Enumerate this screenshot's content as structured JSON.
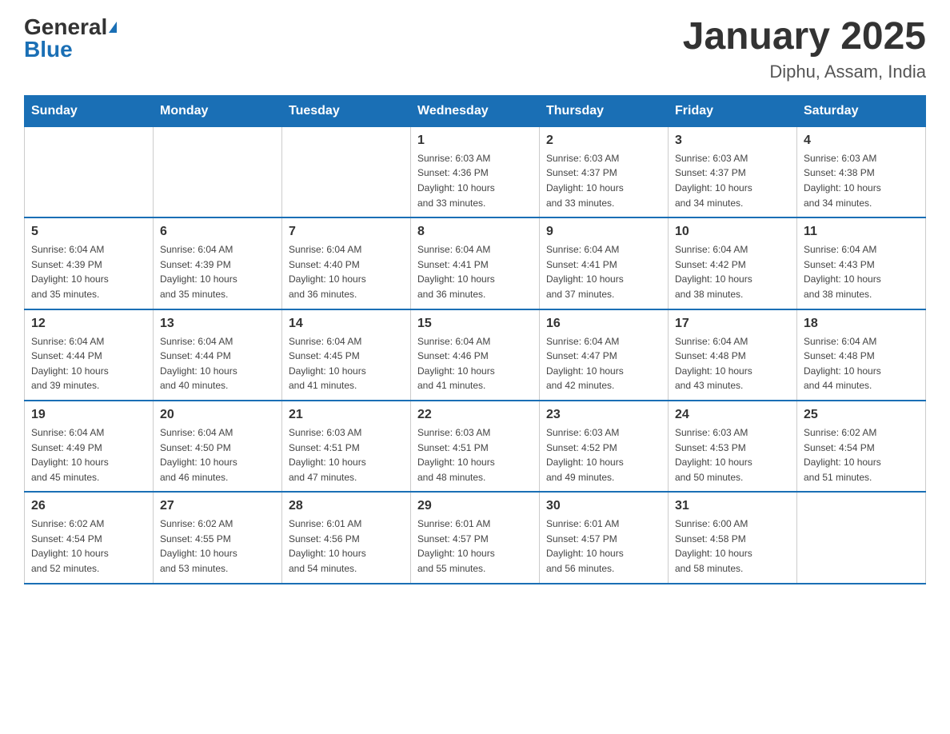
{
  "logo": {
    "general": "General",
    "blue": "Blue"
  },
  "header": {
    "title": "January 2025",
    "subtitle": "Diphu, Assam, India"
  },
  "weekdays": [
    "Sunday",
    "Monday",
    "Tuesday",
    "Wednesday",
    "Thursday",
    "Friday",
    "Saturday"
  ],
  "weeks": [
    [
      {
        "day": "",
        "info": ""
      },
      {
        "day": "",
        "info": ""
      },
      {
        "day": "",
        "info": ""
      },
      {
        "day": "1",
        "info": "Sunrise: 6:03 AM\nSunset: 4:36 PM\nDaylight: 10 hours\nand 33 minutes."
      },
      {
        "day": "2",
        "info": "Sunrise: 6:03 AM\nSunset: 4:37 PM\nDaylight: 10 hours\nand 33 minutes."
      },
      {
        "day": "3",
        "info": "Sunrise: 6:03 AM\nSunset: 4:37 PM\nDaylight: 10 hours\nand 34 minutes."
      },
      {
        "day": "4",
        "info": "Sunrise: 6:03 AM\nSunset: 4:38 PM\nDaylight: 10 hours\nand 34 minutes."
      }
    ],
    [
      {
        "day": "5",
        "info": "Sunrise: 6:04 AM\nSunset: 4:39 PM\nDaylight: 10 hours\nand 35 minutes."
      },
      {
        "day": "6",
        "info": "Sunrise: 6:04 AM\nSunset: 4:39 PM\nDaylight: 10 hours\nand 35 minutes."
      },
      {
        "day": "7",
        "info": "Sunrise: 6:04 AM\nSunset: 4:40 PM\nDaylight: 10 hours\nand 36 minutes."
      },
      {
        "day": "8",
        "info": "Sunrise: 6:04 AM\nSunset: 4:41 PM\nDaylight: 10 hours\nand 36 minutes."
      },
      {
        "day": "9",
        "info": "Sunrise: 6:04 AM\nSunset: 4:41 PM\nDaylight: 10 hours\nand 37 minutes."
      },
      {
        "day": "10",
        "info": "Sunrise: 6:04 AM\nSunset: 4:42 PM\nDaylight: 10 hours\nand 38 minutes."
      },
      {
        "day": "11",
        "info": "Sunrise: 6:04 AM\nSunset: 4:43 PM\nDaylight: 10 hours\nand 38 minutes."
      }
    ],
    [
      {
        "day": "12",
        "info": "Sunrise: 6:04 AM\nSunset: 4:44 PM\nDaylight: 10 hours\nand 39 minutes."
      },
      {
        "day": "13",
        "info": "Sunrise: 6:04 AM\nSunset: 4:44 PM\nDaylight: 10 hours\nand 40 minutes."
      },
      {
        "day": "14",
        "info": "Sunrise: 6:04 AM\nSunset: 4:45 PM\nDaylight: 10 hours\nand 41 minutes."
      },
      {
        "day": "15",
        "info": "Sunrise: 6:04 AM\nSunset: 4:46 PM\nDaylight: 10 hours\nand 41 minutes."
      },
      {
        "day": "16",
        "info": "Sunrise: 6:04 AM\nSunset: 4:47 PM\nDaylight: 10 hours\nand 42 minutes."
      },
      {
        "day": "17",
        "info": "Sunrise: 6:04 AM\nSunset: 4:48 PM\nDaylight: 10 hours\nand 43 minutes."
      },
      {
        "day": "18",
        "info": "Sunrise: 6:04 AM\nSunset: 4:48 PM\nDaylight: 10 hours\nand 44 minutes."
      }
    ],
    [
      {
        "day": "19",
        "info": "Sunrise: 6:04 AM\nSunset: 4:49 PM\nDaylight: 10 hours\nand 45 minutes."
      },
      {
        "day": "20",
        "info": "Sunrise: 6:04 AM\nSunset: 4:50 PM\nDaylight: 10 hours\nand 46 minutes."
      },
      {
        "day": "21",
        "info": "Sunrise: 6:03 AM\nSunset: 4:51 PM\nDaylight: 10 hours\nand 47 minutes."
      },
      {
        "day": "22",
        "info": "Sunrise: 6:03 AM\nSunset: 4:51 PM\nDaylight: 10 hours\nand 48 minutes."
      },
      {
        "day": "23",
        "info": "Sunrise: 6:03 AM\nSunset: 4:52 PM\nDaylight: 10 hours\nand 49 minutes."
      },
      {
        "day": "24",
        "info": "Sunrise: 6:03 AM\nSunset: 4:53 PM\nDaylight: 10 hours\nand 50 minutes."
      },
      {
        "day": "25",
        "info": "Sunrise: 6:02 AM\nSunset: 4:54 PM\nDaylight: 10 hours\nand 51 minutes."
      }
    ],
    [
      {
        "day": "26",
        "info": "Sunrise: 6:02 AM\nSunset: 4:54 PM\nDaylight: 10 hours\nand 52 minutes."
      },
      {
        "day": "27",
        "info": "Sunrise: 6:02 AM\nSunset: 4:55 PM\nDaylight: 10 hours\nand 53 minutes."
      },
      {
        "day": "28",
        "info": "Sunrise: 6:01 AM\nSunset: 4:56 PM\nDaylight: 10 hours\nand 54 minutes."
      },
      {
        "day": "29",
        "info": "Sunrise: 6:01 AM\nSunset: 4:57 PM\nDaylight: 10 hours\nand 55 minutes."
      },
      {
        "day": "30",
        "info": "Sunrise: 6:01 AM\nSunset: 4:57 PM\nDaylight: 10 hours\nand 56 minutes."
      },
      {
        "day": "31",
        "info": "Sunrise: 6:00 AM\nSunset: 4:58 PM\nDaylight: 10 hours\nand 58 minutes."
      },
      {
        "day": "",
        "info": ""
      }
    ]
  ]
}
